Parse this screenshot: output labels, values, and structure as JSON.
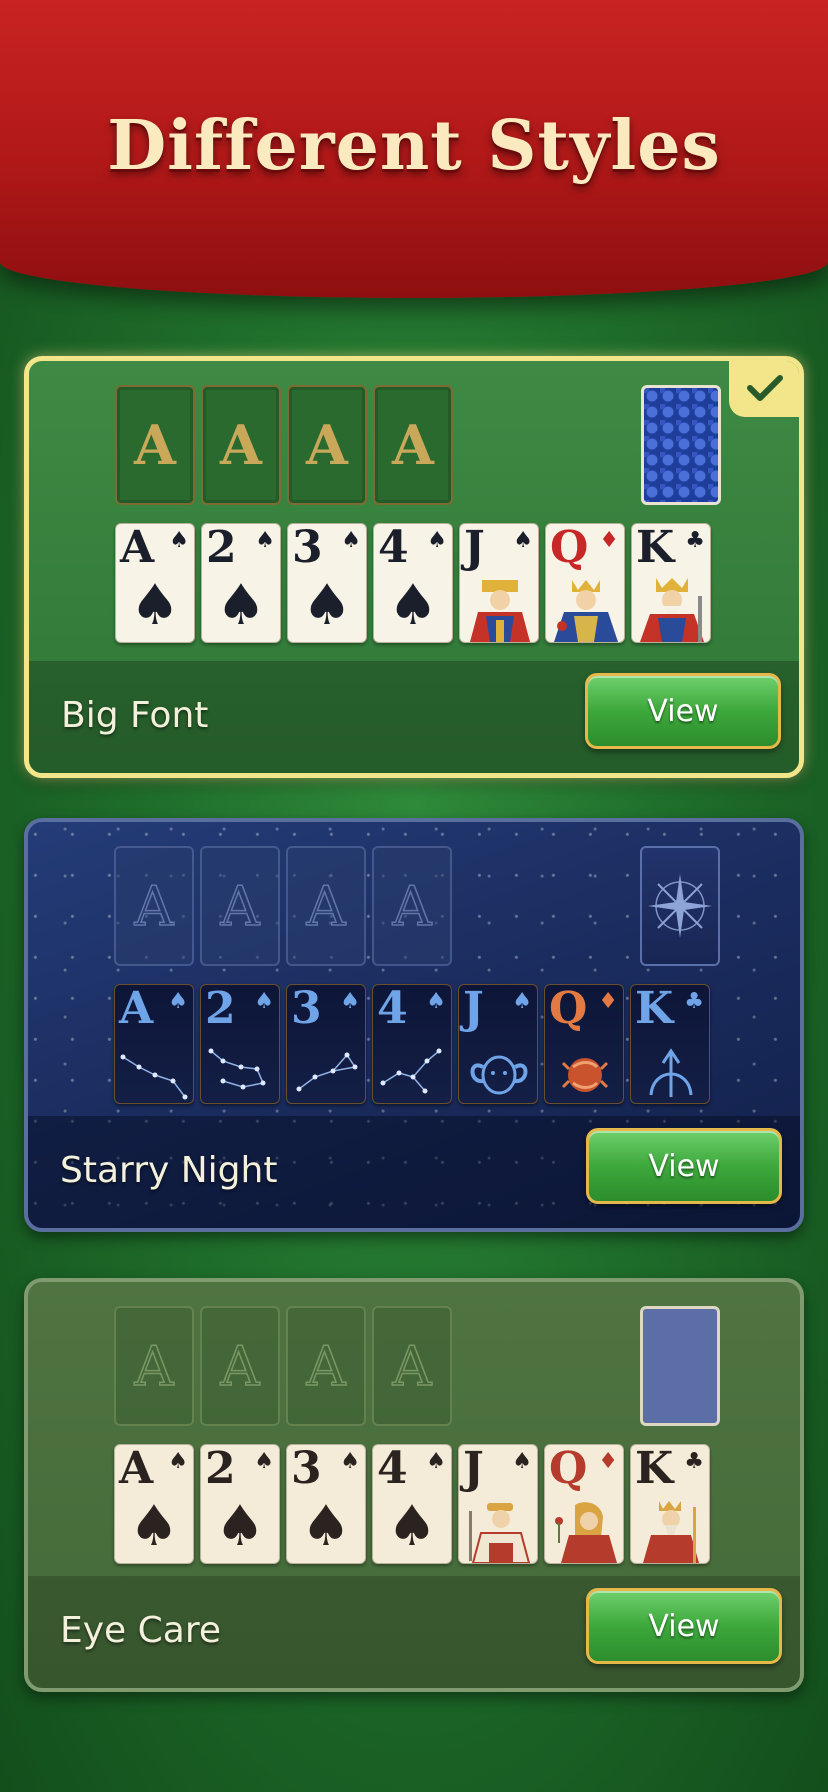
{
  "header": {
    "title": "Different Styles"
  },
  "styles": [
    {
      "name": "Big Font",
      "button": "View",
      "selected": true,
      "foundations": [
        "A",
        "A",
        "A",
        "A"
      ],
      "cards": [
        {
          "rank": "A",
          "suit": "♠"
        },
        {
          "rank": "2",
          "suit": "♠"
        },
        {
          "rank": "3",
          "suit": "♠"
        },
        {
          "rank": "4",
          "suit": "♠"
        },
        {
          "rank": "J",
          "suit": "♠"
        },
        {
          "rank": "Q",
          "suit": "♦"
        },
        {
          "rank": "K",
          "suit": "♣"
        }
      ]
    },
    {
      "name": "Starry Night",
      "button": "View",
      "selected": false,
      "foundations": [
        "A",
        "A",
        "A",
        "A"
      ],
      "cards": [
        {
          "rank": "A",
          "suit": "♠"
        },
        {
          "rank": "2",
          "suit": "♠"
        },
        {
          "rank": "3",
          "suit": "♠"
        },
        {
          "rank": "4",
          "suit": "♠"
        },
        {
          "rank": "J",
          "suit": "♠"
        },
        {
          "rank": "Q",
          "suit": "♦"
        },
        {
          "rank": "K",
          "suit": "♣"
        }
      ]
    },
    {
      "name": "Eye Care",
      "button": "View",
      "selected": false,
      "foundations": [
        "A",
        "A",
        "A",
        "A"
      ],
      "cards": [
        {
          "rank": "A",
          "suit": "♠"
        },
        {
          "rank": "2",
          "suit": "♠"
        },
        {
          "rank": "3",
          "suit": "♠"
        },
        {
          "rank": "4",
          "suit": "♠"
        },
        {
          "rank": "J",
          "suit": "♠"
        },
        {
          "rank": "Q",
          "suit": "♦"
        },
        {
          "rank": "K",
          "suit": "♣"
        }
      ]
    }
  ],
  "colors": {
    "banner_red": "#b01818",
    "felt_green": "#1f6e2b",
    "selection_gold": "#f2e58a",
    "button_green": "#3da83c"
  },
  "icons": [
    "checkmark-icon",
    "spade-icon",
    "diamond-icon",
    "club-icon"
  ]
}
